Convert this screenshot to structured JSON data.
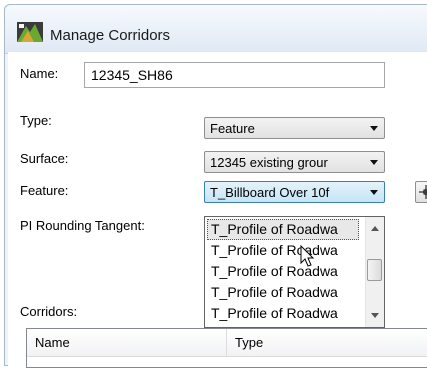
{
  "window": {
    "title": "Manage Corridors",
    "icon": "corridor-app-icon"
  },
  "form": {
    "name_label": "Name:",
    "name_value": "12345_SH86",
    "type_label": "Type:",
    "type_value": "Feature",
    "surface_label": "Surface:",
    "surface_value": "12345 existing grour",
    "feature_label": "Feature:",
    "feature_value": "T_Billboard Over 10f",
    "pi_rounding_label": "PI Rounding Tangent:",
    "corridors_label": "Corridors:"
  },
  "dropdown": {
    "items": [
      "T_Profile of Roadwa",
      "T_Profile of Roadwa",
      "T_Profile of Roadwa",
      "T_Profile of Roadwa",
      "T_Profile of Roadwa"
    ],
    "selected_index": 0
  },
  "table": {
    "columns": [
      "Name",
      "Type"
    ]
  }
}
